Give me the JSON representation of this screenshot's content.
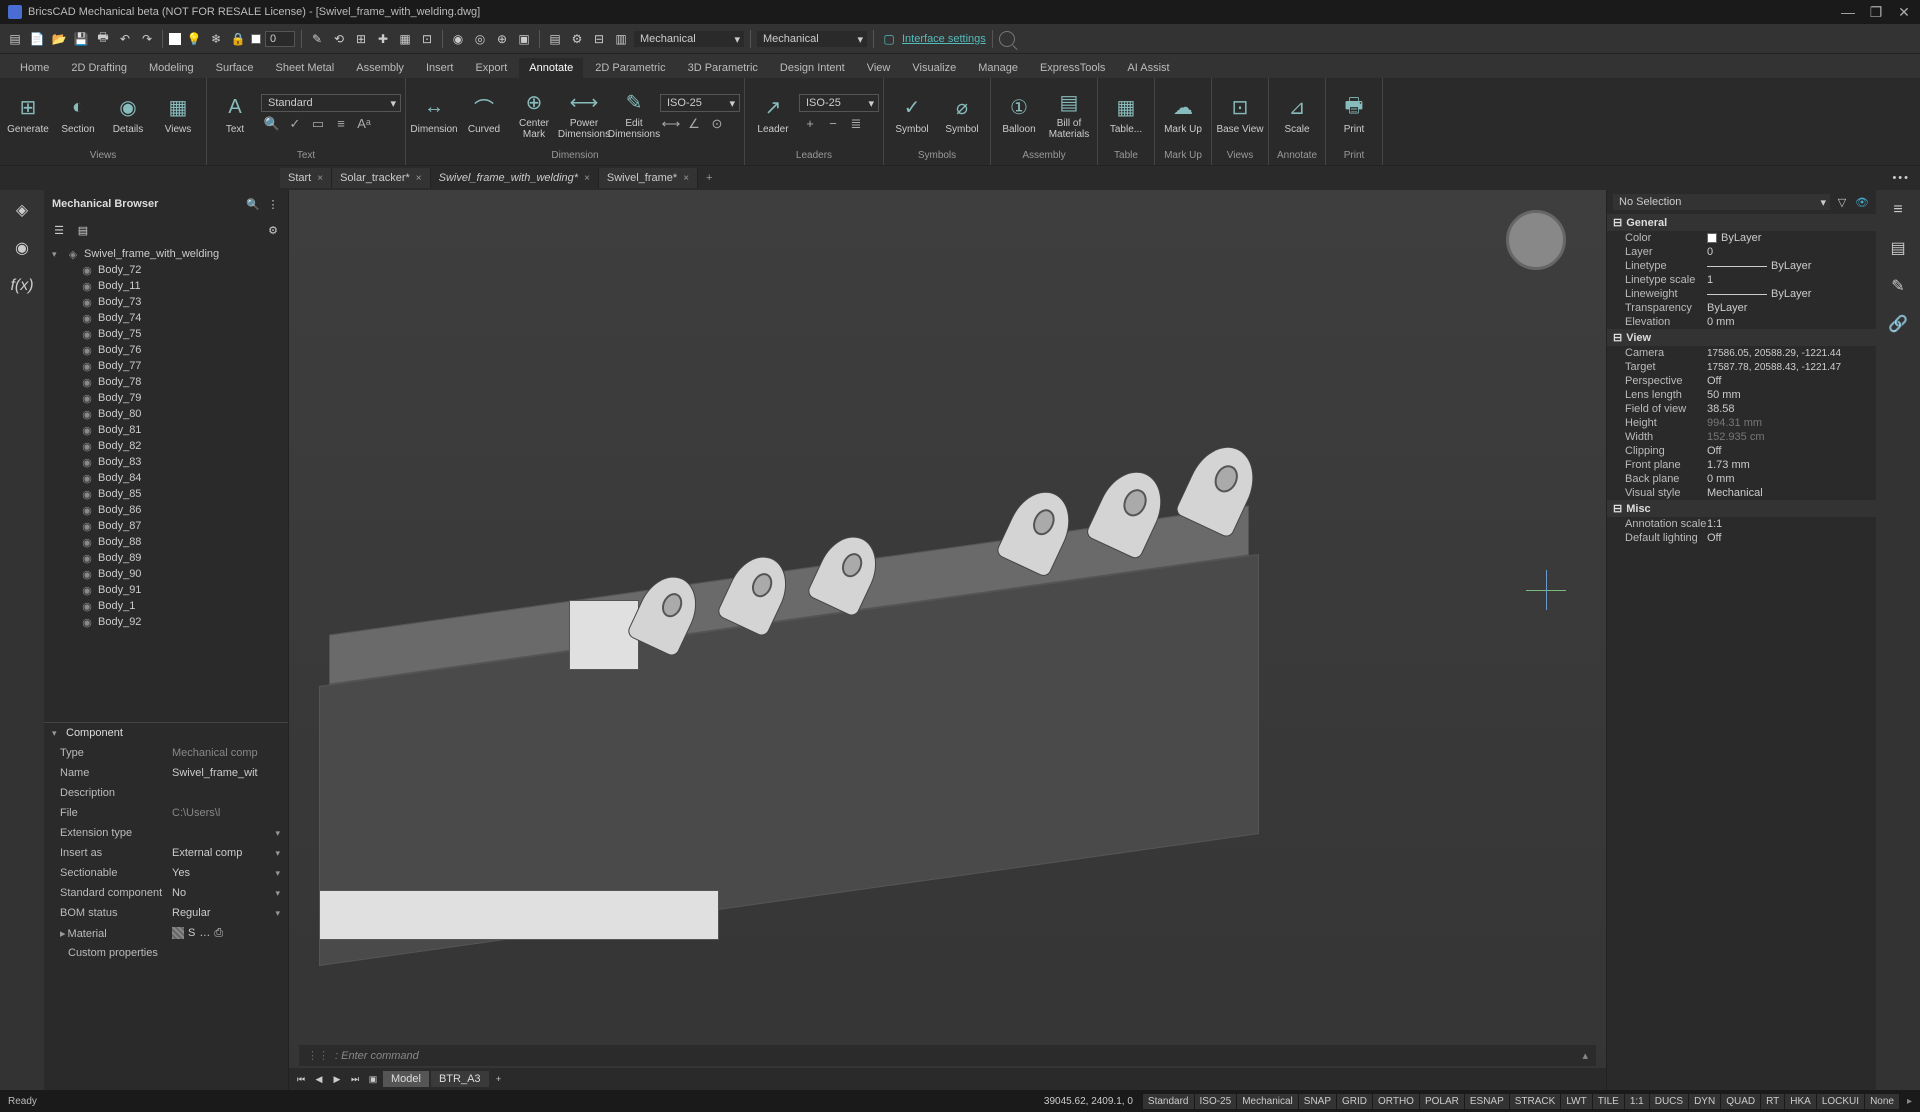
{
  "app": {
    "title": "BricsCAD Mechanical beta (NOT FOR RESALE License) - [Swivel_frame_with_welding.dwg]"
  },
  "quick": {
    "layer_value": "0",
    "workspace1": "Mechanical",
    "workspace2": "Mechanical",
    "iface": "Interface settings"
  },
  "menu": {
    "tabs": [
      "Home",
      "2D Drafting",
      "Modeling",
      "Surface",
      "Sheet Metal",
      "Assembly",
      "Insert",
      "Export",
      "Annotate",
      "2D Parametric",
      "3D Parametric",
      "Design Intent",
      "View",
      "Visualize",
      "Manage",
      "ExpressTools",
      "AI Assist"
    ],
    "active": "Annotate"
  },
  "ribbon": {
    "groups": {
      "views": {
        "label": "Views",
        "generate": "Generate",
        "section": "Section",
        "details": "Details",
        "views": "Views"
      },
      "text": {
        "label": "Text",
        "text": "Text",
        "style": "Standard"
      },
      "dimension": {
        "label": "Dimension",
        "dimension": "Dimension",
        "curved": "Curved",
        "center_mark": "Center Mark",
        "power": "Power Dimensions",
        "edit": "Edit Dimensions",
        "style": "ISO-25"
      },
      "leaders": {
        "label": "Leaders",
        "leader": "Leader",
        "style": "ISO-25"
      },
      "symbols": {
        "label": "Symbols",
        "symbol": "Symbol",
        "symbol2": "Symbol"
      },
      "assembly": {
        "label": "Assembly",
        "balloon": "Balloon",
        "bom": "Bill of Materials"
      },
      "table": {
        "label": "Table",
        "table": "Table..."
      },
      "markup": {
        "label": "Mark Up",
        "markup": "Mark Up"
      },
      "views2": {
        "label": "Views",
        "base": "Base View"
      },
      "annotate": {
        "label": "Annotate",
        "scale": "Scale"
      },
      "print": {
        "label": "Print",
        "print": "Print"
      }
    }
  },
  "docs": {
    "tabs": [
      {
        "name": "Start",
        "active": false
      },
      {
        "name": "Solar_tracker*",
        "active": false
      },
      {
        "name": "Swivel_frame_with_welding*",
        "active": true
      },
      {
        "name": "Swivel_frame*",
        "active": false
      }
    ]
  },
  "browser": {
    "title": "Mechanical Browser",
    "root": "Swivel_frame_with_welding",
    "bodies": [
      "Body_72",
      "Body_11",
      "Body_73",
      "Body_74",
      "Body_75",
      "Body_76",
      "Body_77",
      "Body_78",
      "Body_79",
      "Body_80",
      "Body_81",
      "Body_82",
      "Body_83",
      "Body_84",
      "Body_85",
      "Body_86",
      "Body_87",
      "Body_88",
      "Body_89",
      "Body_90",
      "Body_91",
      "Body_1",
      "Body_92"
    ]
  },
  "component": {
    "header": "Component",
    "rows": {
      "type": {
        "label": "Type",
        "value": "Mechanical comp"
      },
      "name": {
        "label": "Name",
        "value": "Swivel_frame_wit"
      },
      "desc": {
        "label": "Description",
        "value": ""
      },
      "file": {
        "label": "File",
        "value": "C:\\Users\\l"
      },
      "ext": {
        "label": "Extension type",
        "value": ""
      },
      "insert": {
        "label": "Insert as",
        "value": "External comp"
      },
      "section": {
        "label": "Sectionable",
        "value": "Yes"
      },
      "standard": {
        "label": "Standard component",
        "value": "No"
      },
      "bom": {
        "label": "BOM status",
        "value": "Regular"
      },
      "material": {
        "label": "Material",
        "value": "S"
      },
      "custom": {
        "label": "Custom properties",
        "value": ""
      }
    }
  },
  "props": {
    "selection": "No Selection",
    "general": {
      "header": "General",
      "color": {
        "label": "Color",
        "value": "ByLayer"
      },
      "layer": {
        "label": "Layer",
        "value": "0"
      },
      "linetype": {
        "label": "Linetype",
        "value": "ByLayer"
      },
      "ltscale": {
        "label": "Linetype scale",
        "value": "1"
      },
      "lineweight": {
        "label": "Lineweight",
        "value": "ByLayer"
      },
      "transparency": {
        "label": "Transparency",
        "value": "ByLayer"
      },
      "elevation": {
        "label": "Elevation",
        "value": "0 mm"
      }
    },
    "view": {
      "header": "View",
      "camera": {
        "label": "Camera",
        "value": "17586.05, 20588.29, -1221.44"
      },
      "target": {
        "label": "Target",
        "value": "17587.78, 20588.43, -1221.47"
      },
      "perspective": {
        "label": "Perspective",
        "value": "Off"
      },
      "lens": {
        "label": "Lens length",
        "value": "50 mm"
      },
      "fov": {
        "label": "Field of view",
        "value": "38.58"
      },
      "height": {
        "label": "Height",
        "value": "994.31 mm"
      },
      "width": {
        "label": "Width",
        "value": "152.935 cm"
      },
      "clipping": {
        "label": "Clipping",
        "value": "Off"
      },
      "front": {
        "label": "Front plane",
        "value": "1.73 mm"
      },
      "back": {
        "label": "Back plane",
        "value": "0 mm"
      },
      "vstyle": {
        "label": "Visual style",
        "value": "Mechanical"
      }
    },
    "misc": {
      "header": "Misc",
      "ascale": {
        "label": "Annotation scale",
        "value": "1:1"
      },
      "lighting": {
        "label": "Default lighting",
        "value": "Off"
      }
    }
  },
  "viewport": {
    "cmd_prompt": ": Enter command",
    "model_tabs": {
      "model": "Model",
      "layout": "BTR_A3"
    }
  },
  "statusbar": {
    "ready": "Ready",
    "coords": "39045.62, 2409.1, 0",
    "cells": [
      "Standard",
      "ISO-25",
      "Mechanical",
      "SNAP",
      "GRID",
      "ORTHO",
      "POLAR",
      "ESNAP",
      "STRACK",
      "LWT",
      "TILE",
      "1:1",
      "DUCS",
      "DYN",
      "QUAD",
      "RT",
      "HKA",
      "LOCKUI",
      "None"
    ]
  }
}
